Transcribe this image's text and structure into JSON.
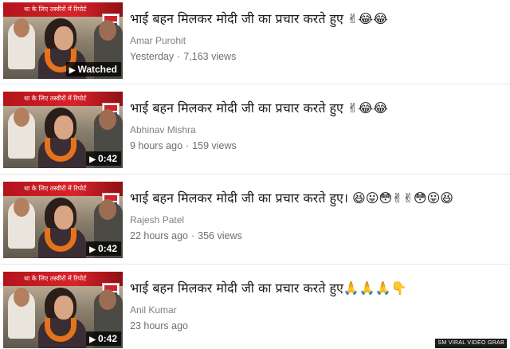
{
  "thumbnail": {
    "banner_text": "था के लिए तस्वीरों में रिपोर्ट",
    "channel_logo": "ABP"
  },
  "videos": [
    {
      "title": "भाई बहन मिलकर मोदी जी का प्रचार करते हुए ✌😂😂",
      "channel": "Amar Purohit",
      "age": "Yesterday",
      "separator": "·",
      "views": "7,163 views",
      "badge": "Watched",
      "badge_icon": "▶"
    },
    {
      "title": "भाई बहन मिलकर मोदी जी का प्रचार करते हुए ✌😂😂",
      "channel": "Abhinav Mishra",
      "age": "9 hours ago",
      "separator": "·",
      "views": "159 views",
      "badge": "0:42",
      "badge_icon": "▶"
    },
    {
      "title": "भाई बहन मिलकर मोदी जी का प्रचार करते हुए। 😆😛😳✌✌😳😛😆",
      "channel": "Rajesh Patel",
      "age": "22 hours ago",
      "separator": "·",
      "views": "356 views",
      "badge": "0:42",
      "badge_icon": "▶"
    },
    {
      "title": "भाई बहन मिलकर मोदी जी का प्रचार करते हुए🙏🙏🙏👇",
      "channel": "Anil Kumar",
      "age": "23 hours ago",
      "separator": "",
      "views": "",
      "badge": "0:42",
      "badge_icon": "▶"
    }
  ],
  "credit": "SM VIRAL VIDEO GRAB",
  "colors": {
    "separator": "#e6e6e6",
    "title_text": "#1a1a1a",
    "meta_text": "#6e6e6e",
    "badge_bg": "#000000"
  }
}
